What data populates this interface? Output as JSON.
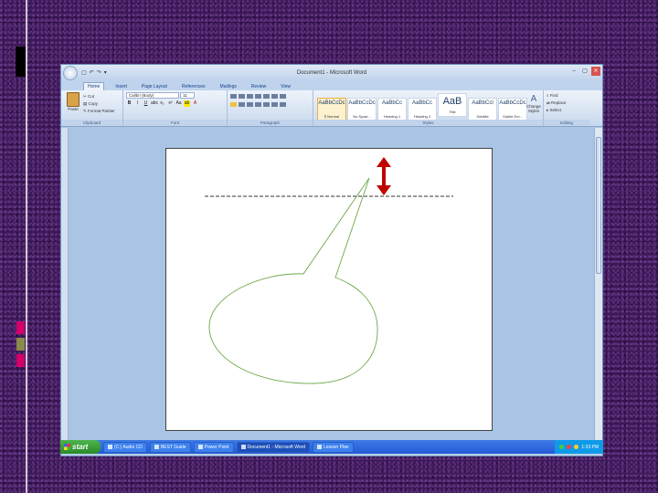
{
  "window": {
    "title": "Document1 - Microsoft Word",
    "qat": [
      "▢",
      "↶",
      "↷",
      "▾"
    ],
    "controls": [
      "–",
      "▢",
      "✕"
    ]
  },
  "tabs": [
    "Home",
    "Insert",
    "Page Layout",
    "References",
    "Mailings",
    "Review",
    "View"
  ],
  "clipboard": {
    "label": "Clipboard",
    "paste": "Paste",
    "cut": "Cut",
    "copy": "Copy",
    "format_painter": "Format Painter"
  },
  "font_group": {
    "label": "Font",
    "font_name": "Calibri (Body)",
    "font_size": "11"
  },
  "paragraph_group": {
    "label": "Paragraph"
  },
  "styles_group": {
    "label": "Styles",
    "styles": [
      {
        "sample": "AaBbCcDc",
        "name": "¶ Normal"
      },
      {
        "sample": "AaBbCcDc",
        "name": "No Spaci..."
      },
      {
        "sample": "AaBbCc",
        "name": "Heading 1"
      },
      {
        "sample": "AaBbCc",
        "name": "Heading 2"
      },
      {
        "sample": "AaB",
        "name": "Title"
      },
      {
        "sample": "AaBbCcl",
        "name": "Subtitle"
      },
      {
        "sample": "AaBbCcDc",
        "name": "Subtle Em..."
      }
    ],
    "change_styles": "Change Styles"
  },
  "editing_group": {
    "label": "Editing",
    "find": "Find",
    "replace": "Replace",
    "select": "Select"
  },
  "statusbar": {
    "page": "Page: 1 of 1",
    "words": "Words: 0",
    "zoom": "100%"
  },
  "taskbar": {
    "start": "start",
    "tasks": [
      "(C:) Audio CD",
      "BEST Guide",
      "Power Point",
      "Document1 - Microsoft Word",
      "Lesson Plan"
    ],
    "clock": "1:33 PM"
  },
  "colors": {
    "arrow": "#c00000",
    "callout": "#6fa84a",
    "dash_line": "#333333"
  }
}
